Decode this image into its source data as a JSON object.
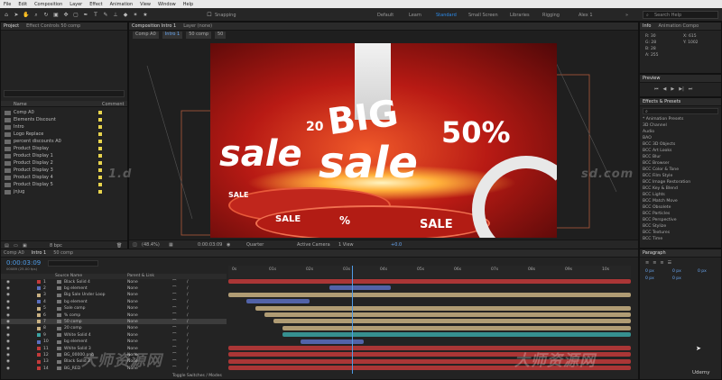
{
  "menu": [
    "File",
    "Edit",
    "Composition",
    "Layer",
    "Effect",
    "Animation",
    "View",
    "Window",
    "Help"
  ],
  "toolbar": {
    "snapping_label": "Snapping",
    "workspaces": [
      "Default",
      "Learn",
      "Standard",
      "Small Screen",
      "Libraries",
      "Rigging",
      "Alex 1"
    ],
    "active_workspace": "Standard",
    "search_placeholder": "Search Help"
  },
  "project_panel": {
    "tab_project": "Project",
    "tab_effect_controls": "Effect Controls 50 comp",
    "col_name": "Name",
    "col_comment": "Comment",
    "items": [
      {
        "name": "Comp A0",
        "color": "#e8d44d"
      },
      {
        "name": "Elements Discount",
        "color": "#e8d44d"
      },
      {
        "name": "Intro",
        "color": "#e8d44d"
      },
      {
        "name": "Logo Replace",
        "color": "#e8d44d"
      },
      {
        "name": "percent discounts A0",
        "color": "#e8d44d"
      },
      {
        "name": "Product Display",
        "color": "#e8d44d"
      },
      {
        "name": "Product Display 1",
        "color": "#e8d44d"
      },
      {
        "name": "Product Display 2",
        "color": "#e8d44d"
      },
      {
        "name": "Product Display 3",
        "color": "#e8d44d"
      },
      {
        "name": "Product Display 4",
        "color": "#e8d44d"
      },
      {
        "name": "Product Display 5",
        "color": "#e8d44d"
      },
      {
        "name": "jnjug",
        "color": "#e8d44d"
      }
    ],
    "bpc": "8 bpc"
  },
  "viewer": {
    "tab_composition": "Composition Intro 1",
    "tab_layer": "Layer (none)",
    "breadcrumbs": [
      "Comp A0",
      "Intro 1",
      "50 comp",
      "50"
    ],
    "zoom": "(48.4%)",
    "timecode": "0:00:03:09",
    "quality": "Quarter",
    "camera": "Active Camera",
    "views": "1 View",
    "exposure": "+0.0",
    "artwork": {
      "big": "BIG",
      "sale1": "sale",
      "sale2": "sale",
      "percent": "50%",
      "two0": "20",
      "sale_tag": "SALE",
      "pct": "%",
      "sale_tag2": "SALE"
    }
  },
  "info_panel": {
    "tab_info": "Info",
    "tab_audio": "Animation Compo",
    "r": "R: 30",
    "g": "G: 28",
    "b": "B: 28",
    "a": "A: 255",
    "x": "X: 615",
    "y": "Y: 1002"
  },
  "preview_panel": {
    "title": "Preview"
  },
  "effects_panel": {
    "title": "Effects & Presets",
    "search_placeholder": "",
    "items": [
      "* Animation Presets",
      "3D Channel",
      "Audio",
      "BAO",
      "BCC 3D Objects",
      "BCC Art Looks",
      "BCC Blur",
      "BCC Browser",
      "BCC Color & Tone",
      "BCC Film Style",
      "BCC Image Restoration",
      "BCC Key & Blend",
      "BCC Lights",
      "BCC Match Move",
      "BCC Obsolete",
      "BCC Particles",
      "BCC Perspective",
      "BCC Stylize",
      "BCC Textures",
      "BCC Time"
    ]
  },
  "paragraph_panel": {
    "title": "Paragraph",
    "values": [
      "0 px",
      "0 px",
      "0 px",
      "0 px",
      "0 px"
    ]
  },
  "timeline": {
    "tabs": [
      "Comp A0",
      "Intro 1",
      "50 comp"
    ],
    "timecode": "0:00:03:09",
    "fps": "00089 (25.00 fps)",
    "col_source": "Source Name",
    "col_parent": "Parent & Link",
    "ruler": [
      "0s",
      "01s",
      "02s",
      "03s",
      "04s",
      "05s",
      "06s",
      "07s",
      "08s",
      "09s",
      "10s"
    ],
    "toggle_label": "Toggle Switches / Modes",
    "layers": [
      {
        "num": "1",
        "name": "Black Solid 4",
        "color": "#c23a3a",
        "parent": "None"
      },
      {
        "num": "2",
        "name": "bg element",
        "color": "#5a6fbf",
        "parent": "None"
      },
      {
        "num": "3",
        "name": "Big Sale Under Loop",
        "color": "#c9b182",
        "parent": "None"
      },
      {
        "num": "4",
        "name": "bg element",
        "color": "#5a6fbf",
        "parent": "None"
      },
      {
        "num": "5",
        "name": "Sale comp",
        "color": "#c9b182",
        "parent": "None"
      },
      {
        "num": "6",
        "name": "% comp",
        "color": "#c9b182",
        "parent": "None"
      },
      {
        "num": "7",
        "name": "50 comp",
        "color": "#c9b182",
        "parent": "None"
      },
      {
        "num": "8",
        "name": "20 comp",
        "color": "#c9b182",
        "parent": "None"
      },
      {
        "num": "9",
        "name": "White Solid 4",
        "color": "#3aa3a3",
        "parent": "None"
      },
      {
        "num": "10",
        "name": "bg element",
        "color": "#5a6fbf",
        "parent": "None"
      },
      {
        "num": "11",
        "name": "White Solid 3",
        "color": "#c23a3a",
        "parent": "None"
      },
      {
        "num": "12",
        "name": "BG_00000.png",
        "color": "#c23a3a",
        "parent": "None"
      },
      {
        "num": "13",
        "name": "Black Solid 3",
        "color": "#c23a3a",
        "parent": "None"
      },
      {
        "num": "14",
        "name": "BG_RED",
        "color": "#c23a3a",
        "parent": "None"
      }
    ]
  },
  "watermarks": {
    "top": "1.d",
    "top_right": "sd.com",
    "bottom_left": "大师资源网",
    "bottom_right": "大师资源网",
    "udemy": "Udemy"
  }
}
